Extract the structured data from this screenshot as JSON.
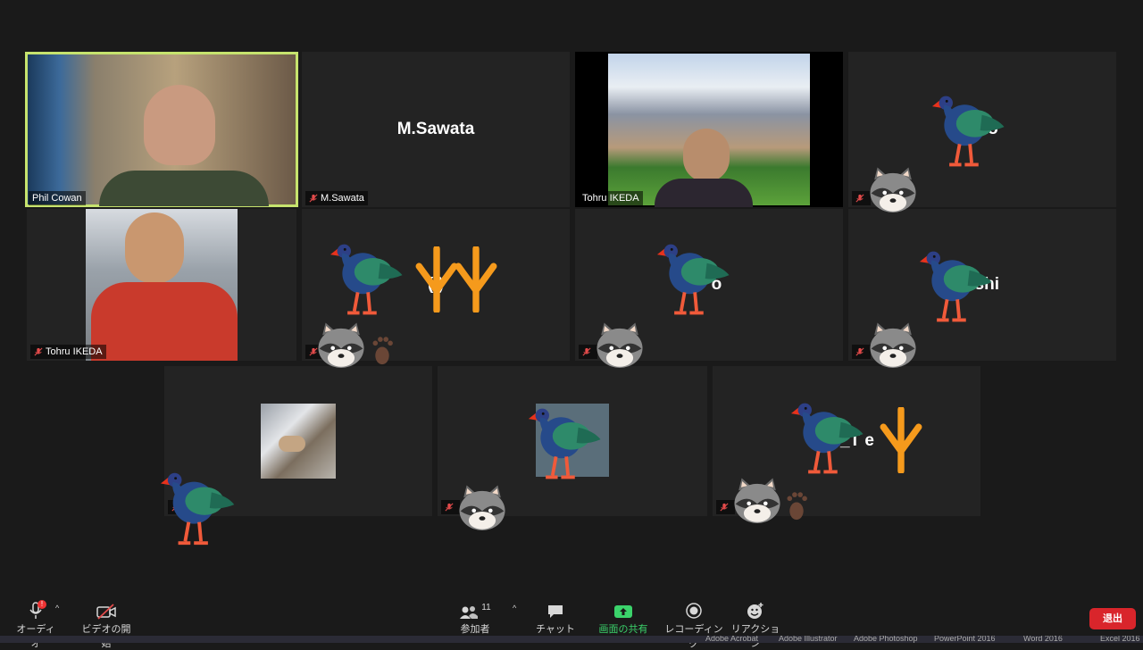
{
  "tiles": [
    {
      "name": "Phil Cowan",
      "center": ""
    },
    {
      "name": "M.Sawata",
      "center": "M.Sawata"
    },
    {
      "name": "Tohru IKEDA",
      "center": ""
    },
    {
      "name": "",
      "center": "Y      to"
    },
    {
      "name": "Tohru IKEDA",
      "center": ""
    },
    {
      "name": "",
      "center": "(       )"
    },
    {
      "name": "",
      "center": "T      o"
    },
    {
      "name": "",
      "center": "      ashi"
    },
    {
      "name": "",
      "center": ""
    },
    {
      "name": "",
      "center": ""
    },
    {
      "name": "",
      "center": "TA_T          e"
    }
  ],
  "toolbar": {
    "audio": "オーディオ",
    "video": "ビデオの開始",
    "participants": "参加者",
    "participants_count": "11",
    "chat": "チャット",
    "share": "画面の共有",
    "record": "レコーディング",
    "reactions": "リアクション",
    "leave": "退出",
    "audio_badge": "!"
  },
  "taskbar": [
    "Adobe Acrobat",
    "Adobe Illustrator",
    "Adobe Photoshop",
    "PowerPoint 2016",
    "Word 2016",
    "Excel 2016"
  ],
  "colors": {
    "active_speaker": "#c6e36e",
    "share_green": "#3bd36b",
    "leave_red": "#d9252b"
  }
}
